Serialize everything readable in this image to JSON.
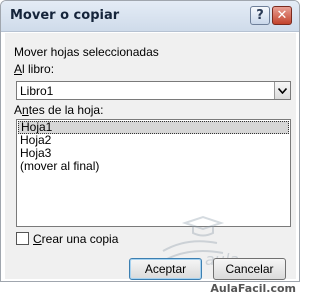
{
  "window": {
    "title": "Mover o copiar"
  },
  "titlebar": {
    "help_glyph": "?",
    "close_glyph": "✕"
  },
  "section_label": "Mover hojas seleccionadas",
  "book": {
    "label_mnemonic": "A",
    "label_rest": "l libro:",
    "value": "Libro1"
  },
  "before": {
    "label_mnemonic": "n",
    "label_prefix": "A",
    "label_rest": "tes de la hoja:",
    "items": [
      "Hoja1",
      "Hoja2",
      "Hoja3",
      "(mover al final)"
    ],
    "selected_index": 0
  },
  "copy": {
    "label_mnemonic": "C",
    "label_rest": "rear una copia",
    "checked": false
  },
  "buttons": {
    "ok": "Aceptar",
    "cancel": "Cancelar"
  },
  "watermark": {
    "text": "aula"
  },
  "footer": {
    "brand": "AulaFacil.com"
  },
  "colors": {
    "title_text": "#15243a",
    "close_button": "#c3432c",
    "default_button_border": "#3c7fb1"
  },
  "icons": [
    "help-icon",
    "close-icon",
    "dropdown-arrow-icon",
    "watermark-logo-icon"
  ]
}
